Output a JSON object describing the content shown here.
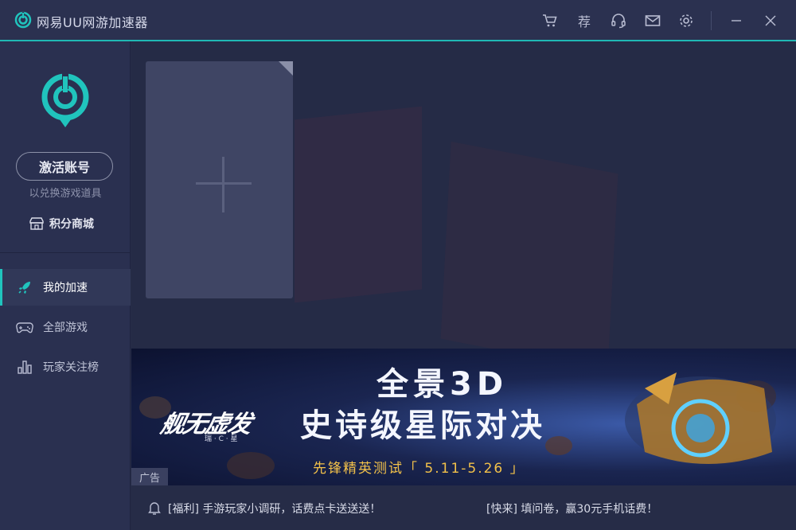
{
  "app": {
    "title": "网易UU网游加速器"
  },
  "titlebar": {
    "icons": [
      "cart-icon",
      "recommend-icon",
      "headset-icon",
      "mail-icon",
      "settings-icon",
      "minimize-icon",
      "close-icon"
    ],
    "recommend_label": "荐"
  },
  "sidebar": {
    "activate_label": "激活账号",
    "activate_sub": "以兑换游戏道具",
    "shop_label": "积分商城",
    "items": [
      {
        "label": "我的加速",
        "icon": "rocket-icon",
        "active": true
      },
      {
        "label": "全部游戏",
        "icon": "gamepad-icon",
        "active": false
      },
      {
        "label": "玩家关注榜",
        "icon": "ranking-icon",
        "active": false
      }
    ]
  },
  "banner": {
    "game_logo": "舰无虚发",
    "game_logo_sub": "瑞 · C · 星",
    "headline_line1": "全景3D",
    "headline_line2": "史诗级星际对决",
    "tagline": "先锋精英测试「 5.11-5.26 」",
    "ad_badge": "广告"
  },
  "notices": [
    "[福利] 手游玩家小调研，话费点卡送送送！",
    "[快来] 填问卷，赢30元手机话费！"
  ],
  "colors": {
    "accent": "#20c4bd",
    "titlebar_bg": "#2b3150",
    "sidebar_bg": "#2a3050",
    "main_bg": "#252b46",
    "tagline": "#f2c14a"
  }
}
